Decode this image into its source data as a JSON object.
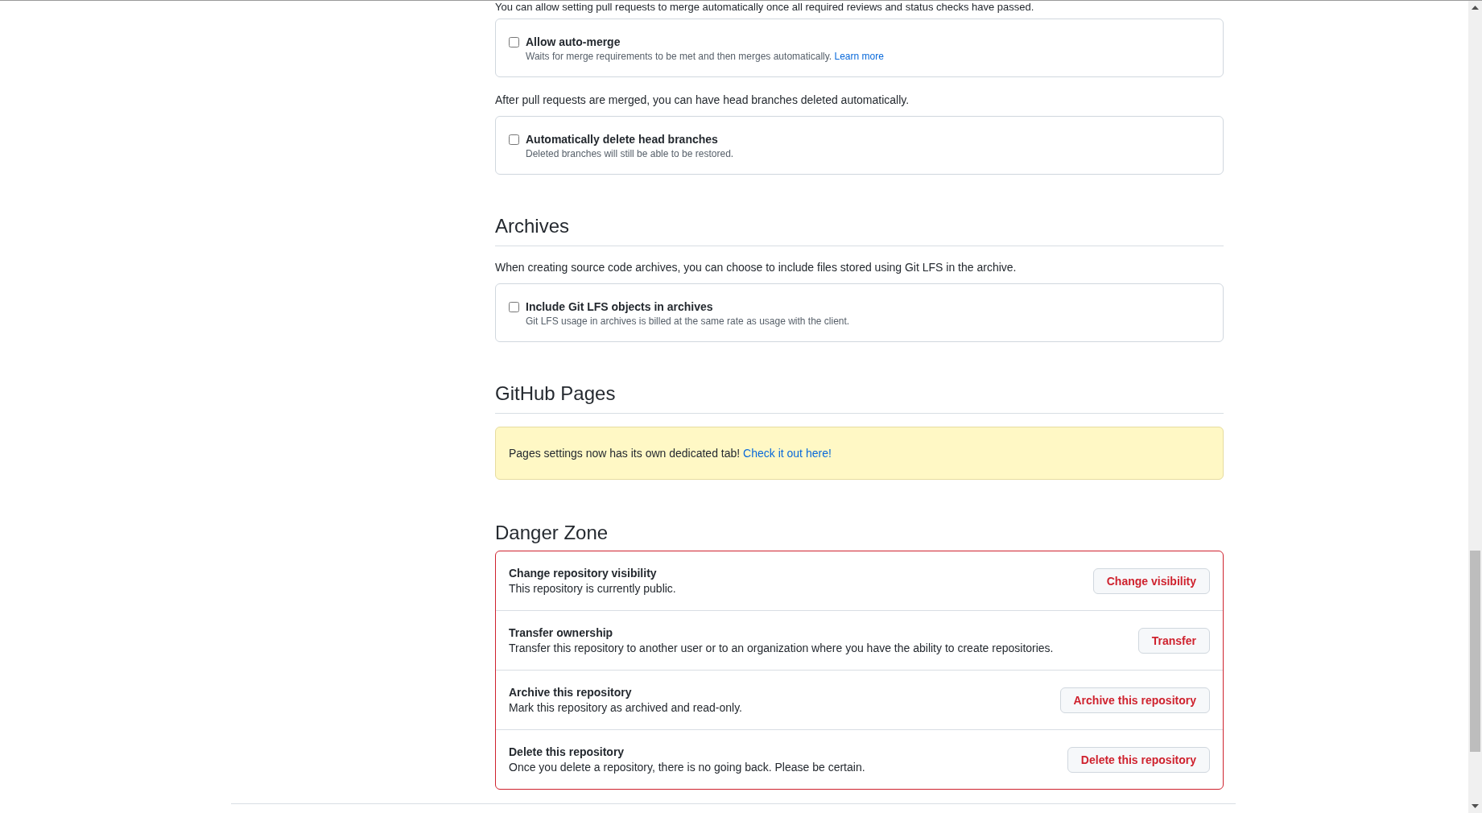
{
  "intro_text": "You can allow setting pull requests to merge automatically once all required reviews and status checks have passed.",
  "merge_options": [
    {
      "label": "Allow auto-merge",
      "description": "Waits for merge requirements to be met and then merges automatically.",
      "link": "Learn more",
      "checked": false
    }
  ],
  "branch_text": "After pull requests are merged, you can have head branches deleted automatically.",
  "branch_options": [
    {
      "label": "Automatically delete head branches",
      "description": "Deleted branches will still be able to be restored.",
      "checked": false
    }
  ],
  "archives": {
    "heading": "Archives",
    "text": "When creating source code archives, you can choose to include files stored using Git LFS in the archive.",
    "options": [
      {
        "label": "Include Git LFS objects in archives",
        "description": "Git LFS usage in archives is billed at the same rate as usage with the client.",
        "checked": false
      }
    ]
  },
  "pages": {
    "heading": "GitHub Pages",
    "notice": "Pages settings now has its own dedicated tab!",
    "link": "Check it out here!"
  },
  "danger_zone": {
    "heading": "Danger Zone",
    "items": [
      {
        "title": "Change repository visibility",
        "description": "This repository is currently public.",
        "button": "Change visibility"
      },
      {
        "title": "Transfer ownership",
        "description": "Transfer this repository to another user or to an organization where you have the ability to create repositories.",
        "button": "Transfer"
      },
      {
        "title": "Archive this repository",
        "description": "Mark this repository as archived and read-only.",
        "button": "Archive this repository"
      },
      {
        "title": "Delete this repository",
        "description": "Once you delete a repository, there is no going back. Please be certain.",
        "button": "Delete this repository"
      }
    ]
  }
}
